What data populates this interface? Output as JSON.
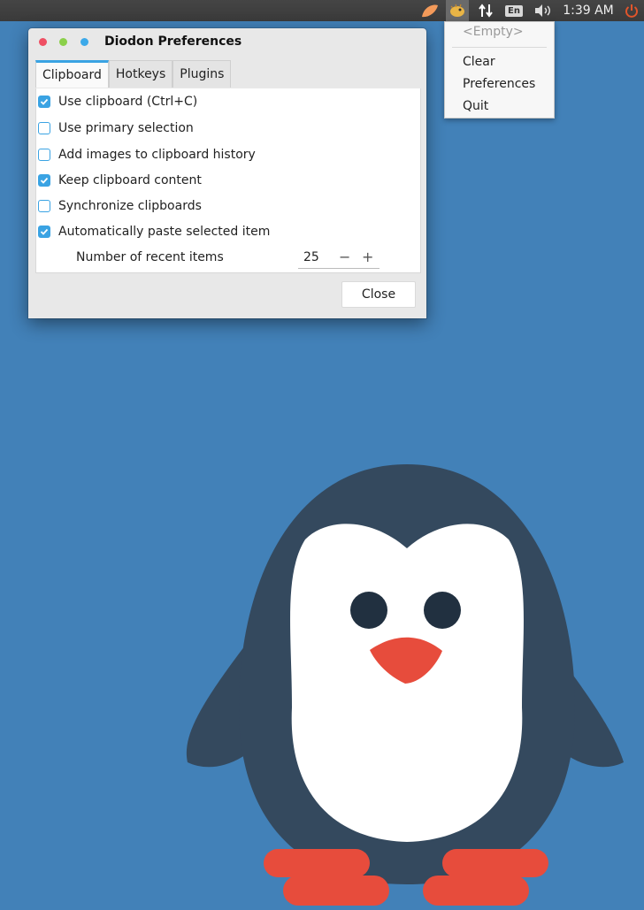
{
  "panel": {
    "indicators": [
      "orange-slice-icon",
      "diodon-icon",
      "network-icon",
      "keyboard-layout",
      "volume-icon",
      "power-icon"
    ],
    "keyboard_layout": "En",
    "clock": "1:39 AM"
  },
  "diodon_menu": {
    "empty_label": "<Empty>",
    "items": [
      {
        "label": "Clear"
      },
      {
        "label": "Preferences"
      },
      {
        "label": "Quit"
      }
    ]
  },
  "dialog": {
    "title": "Diodon Preferences",
    "tabs": [
      {
        "label": "Clipboard",
        "active": true
      },
      {
        "label": "Hotkeys",
        "active": false
      },
      {
        "label": "Plugins",
        "active": false
      }
    ],
    "options": [
      {
        "label": "Use clipboard (Ctrl+C)",
        "checked": true
      },
      {
        "label": "Use primary selection",
        "checked": false
      },
      {
        "label": "Add images to clipboard history",
        "checked": false
      },
      {
        "label": "Keep clipboard content",
        "checked": true
      },
      {
        "label": "Synchronize clipboards",
        "checked": false
      },
      {
        "label": "Automatically paste selected item",
        "checked": true
      }
    ],
    "recent_items_label": "Number of recent items",
    "recent_items_value": "25",
    "spin_minus": "−",
    "spin_plus": "+",
    "close_label": "Close"
  },
  "colors": {
    "desktop": "#4281b8",
    "accent": "#3aa3e3",
    "penguin_body": "#34495e",
    "penguin_belly": "#ffffff",
    "penguin_beak": "#e74c3c"
  }
}
